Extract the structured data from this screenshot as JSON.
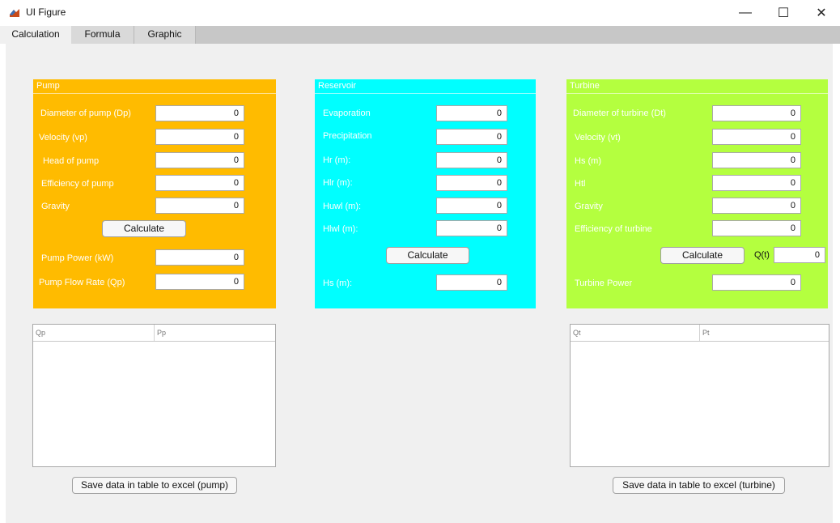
{
  "window": {
    "title": "UI Figure",
    "min_symbol": "—",
    "max_symbol": "☐",
    "close_symbol": "✕"
  },
  "tabs": [
    {
      "label": "Calculation",
      "active": true
    },
    {
      "label": "Formula",
      "active": false
    },
    {
      "label": "Graphic",
      "active": false
    }
  ],
  "colors": {
    "pump": "#ffbb00",
    "reservoir": "#00ffff",
    "turbine": "#b4ff3f",
    "background": "#f0f0f0"
  },
  "pump": {
    "title": "Pump",
    "inputs": [
      {
        "label": "Diameter of pump (Dp)",
        "value": "0"
      },
      {
        "label": "Velocity (vp)",
        "value": "0"
      },
      {
        "label": "Head of pump",
        "value": "0"
      },
      {
        "label": "Efficiency of pump",
        "value": "0"
      },
      {
        "label": "Gravity",
        "value": "0"
      }
    ],
    "calculate_label": "Calculate",
    "outputs": [
      {
        "label": "Pump Power (kW)",
        "value": "0"
      },
      {
        "label": "Pump Flow Rate (Qp)",
        "value": "0"
      }
    ],
    "table_columns": [
      "Qp",
      "Pp"
    ],
    "save_label": "Save data in table to excel (pump)"
  },
  "reservoir": {
    "title": "Reservoir",
    "inputs": [
      {
        "label": "Evaporation",
        "value": "0"
      },
      {
        "label": "Precipitation",
        "value": "0"
      },
      {
        "label": "Hr (m):",
        "value": "0"
      },
      {
        "label": "Hlr (m):",
        "value": "0"
      },
      {
        "label": "Huwl (m):",
        "value": "0"
      },
      {
        "label": "Hlwl (m):",
        "value": "0"
      }
    ],
    "calculate_label": "Calculate",
    "output": {
      "label": "Hs (m):",
      "value": "0"
    }
  },
  "turbine": {
    "title": "Turbine",
    "inputs": [
      {
        "label": "Diameter of turbine (Dt)",
        "value": "0"
      },
      {
        "label": "Velocity (vt)",
        "value": "0"
      },
      {
        "label": "Hs (m)",
        "value": "0"
      },
      {
        "label": "Htl",
        "value": "0"
      },
      {
        "label": "Gravity",
        "value": "0"
      },
      {
        "label": "Efficiency of turbine",
        "value": "0"
      }
    ],
    "calculate_label": "Calculate",
    "qt": {
      "label": "Q(t)",
      "value": "0"
    },
    "output": {
      "label": "Turbine Power",
      "value": "0"
    },
    "table_columns": [
      "Qt",
      "Pt"
    ],
    "save_label": "Save data in table to excel (turbine)"
  }
}
